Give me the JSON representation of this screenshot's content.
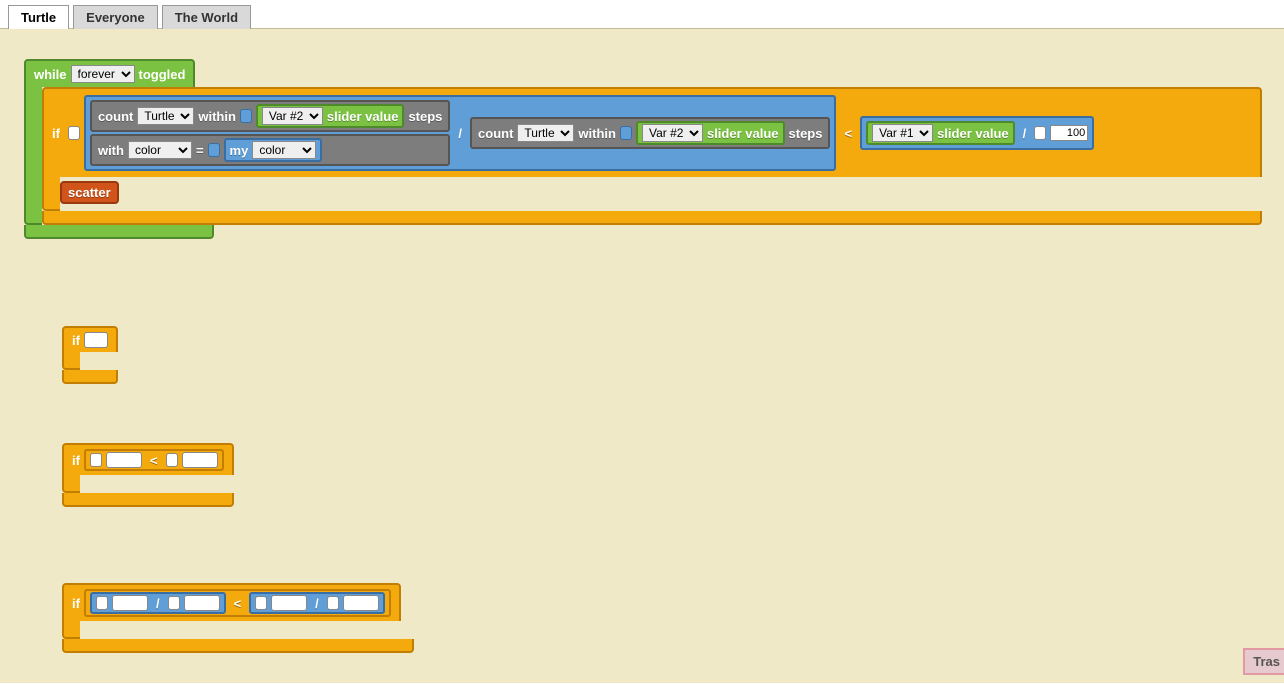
{
  "tabs": [
    "Turtle",
    "Everyone",
    "The World"
  ],
  "active_tab": "Turtle",
  "while_label": "while",
  "while_mode": "forever",
  "toggled_label": "toggled",
  "if_label": "if",
  "scatter_label": "scatter",
  "count": {
    "label_count": "count",
    "breed": "Turtle",
    "label_within": "within",
    "var_dropdown": "Var #2",
    "slider_value_label": "slider value",
    "label_steps": "steps"
  },
  "with": {
    "label_with": "with",
    "trait_select": "color",
    "eq": "=",
    "my_label": "my",
    "my_select": "color"
  },
  "divide_op": "/",
  "lt_op": "<",
  "rhs": {
    "var_dropdown": "Var #1",
    "slider_value_label": "slider value",
    "constant": "100"
  },
  "floating": {
    "if_label": "if",
    "lt_op": "<",
    "divide_op": "/"
  },
  "trash_label": "Tras"
}
